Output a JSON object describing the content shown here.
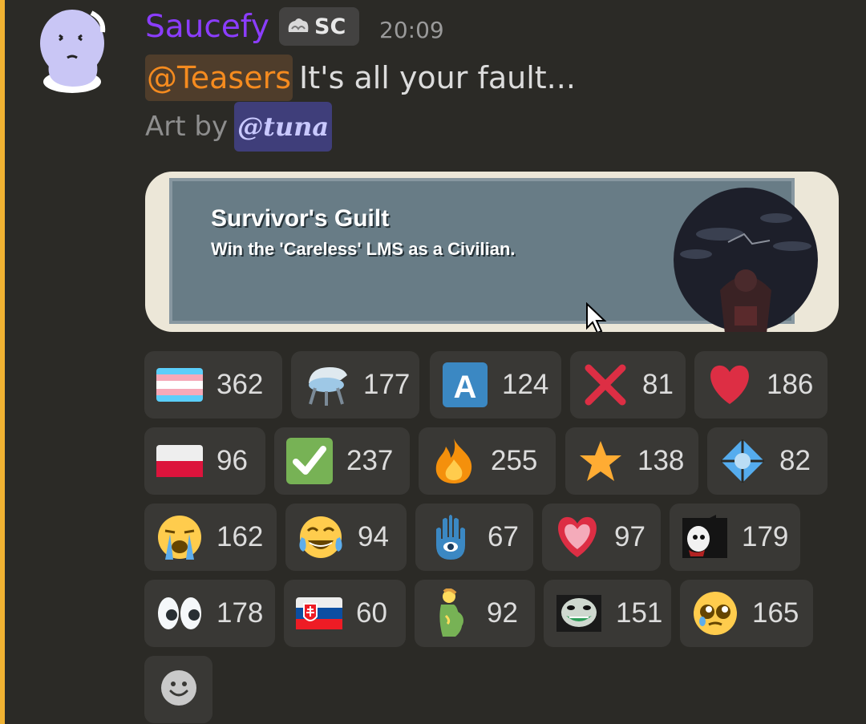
{
  "message": {
    "author": "Saucefy",
    "tag": "SC",
    "timestamp": "20:09",
    "mention": "@Teasers",
    "text": "It's all your fault...",
    "art_prefix": "Art by",
    "art_mention": "@tuna"
  },
  "embed": {
    "title": "Survivor's Guilt",
    "description": "Win the 'Careless' LMS as a Civilian."
  },
  "reactions": [
    {
      "emoji": "transgender-flag",
      "count": "362"
    },
    {
      "emoji": "satellite-dish",
      "count": "177"
    },
    {
      "emoji": "letter-a-button",
      "count": "124"
    },
    {
      "emoji": "cross-mark",
      "count": "81"
    },
    {
      "emoji": "red-heart",
      "count": "186"
    },
    {
      "emoji": "poland-flag",
      "count": "96"
    },
    {
      "emoji": "check-mark-button",
      "count": "237"
    },
    {
      "emoji": "fire",
      "count": "255"
    },
    {
      "emoji": "star",
      "count": "138"
    },
    {
      "emoji": "blue-diamond-shape",
      "count": "82"
    },
    {
      "emoji": "loudly-crying-face",
      "count": "162"
    },
    {
      "emoji": "tears-of-joy-face",
      "count": "94"
    },
    {
      "emoji": "hamsa",
      "count": "67"
    },
    {
      "emoji": "growing-heart",
      "count": "97"
    },
    {
      "emoji": "custom-skull-character",
      "count": "179"
    },
    {
      "emoji": "eyes",
      "count": "178"
    },
    {
      "emoji": "slovakia-flag",
      "count": "60"
    },
    {
      "emoji": "pregnant-person",
      "count": "92"
    },
    {
      "emoji": "custom-green-grin",
      "count": "151"
    },
    {
      "emoji": "pleading-face",
      "count": "165"
    }
  ],
  "colors": {
    "background": "#2b2a26",
    "username": "#8b3dff",
    "mention_highlight": "#f0b232",
    "reaction_bg": "#393835"
  }
}
